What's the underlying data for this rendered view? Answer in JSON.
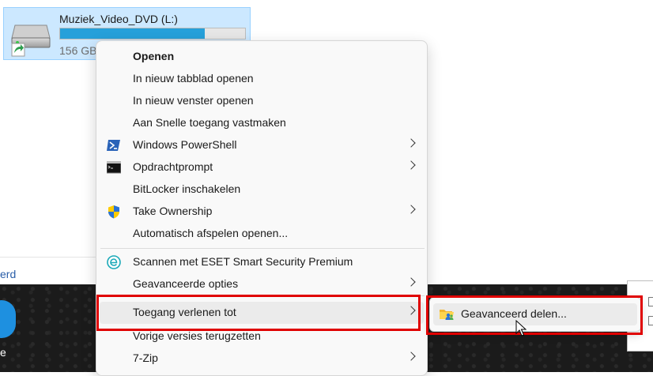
{
  "drive": {
    "name": "Muziek_Video_DVD (L:)",
    "size_text": "156 GB",
    "usage_fraction": 0.78,
    "icon": "drive-icon",
    "shortcut_icon": "shortcut-arrow-icon"
  },
  "background": {
    "partial_text": "erd",
    "desktop_label": "e"
  },
  "menu": {
    "items": [
      {
        "label": "Openen",
        "bold": true
      },
      {
        "label": "In nieuw tabblad openen"
      },
      {
        "label": "In nieuw venster openen"
      },
      {
        "label": "Aan Snelle toegang vastmaken"
      },
      {
        "label": "Windows PowerShell",
        "icon": "powershell-icon",
        "submenu": true
      },
      {
        "label": "Opdrachtprompt",
        "icon": "cmd-icon",
        "submenu": true
      },
      {
        "label": "BitLocker inschakelen"
      },
      {
        "label": "Take Ownership",
        "icon": "shield-icon",
        "submenu": true
      },
      {
        "label": "Automatisch afspelen openen..."
      },
      {
        "label": "Scannen met ESET Smart Security Premium",
        "icon": "eset-icon"
      },
      {
        "label": "Geavanceerde opties",
        "submenu": true
      },
      {
        "label": "Toegang verlenen tot",
        "submenu": true,
        "highlighted": true
      },
      {
        "label": "Vorige versies terugzetten"
      },
      {
        "label": "7-Zip",
        "submenu": true
      }
    ]
  },
  "submenu": {
    "label": "Geavanceerd delen...",
    "icon": "share-folder-icon"
  },
  "colors": {
    "highlight": "#e00000",
    "selection": "#cce8ff",
    "progress": "#26a0da"
  }
}
